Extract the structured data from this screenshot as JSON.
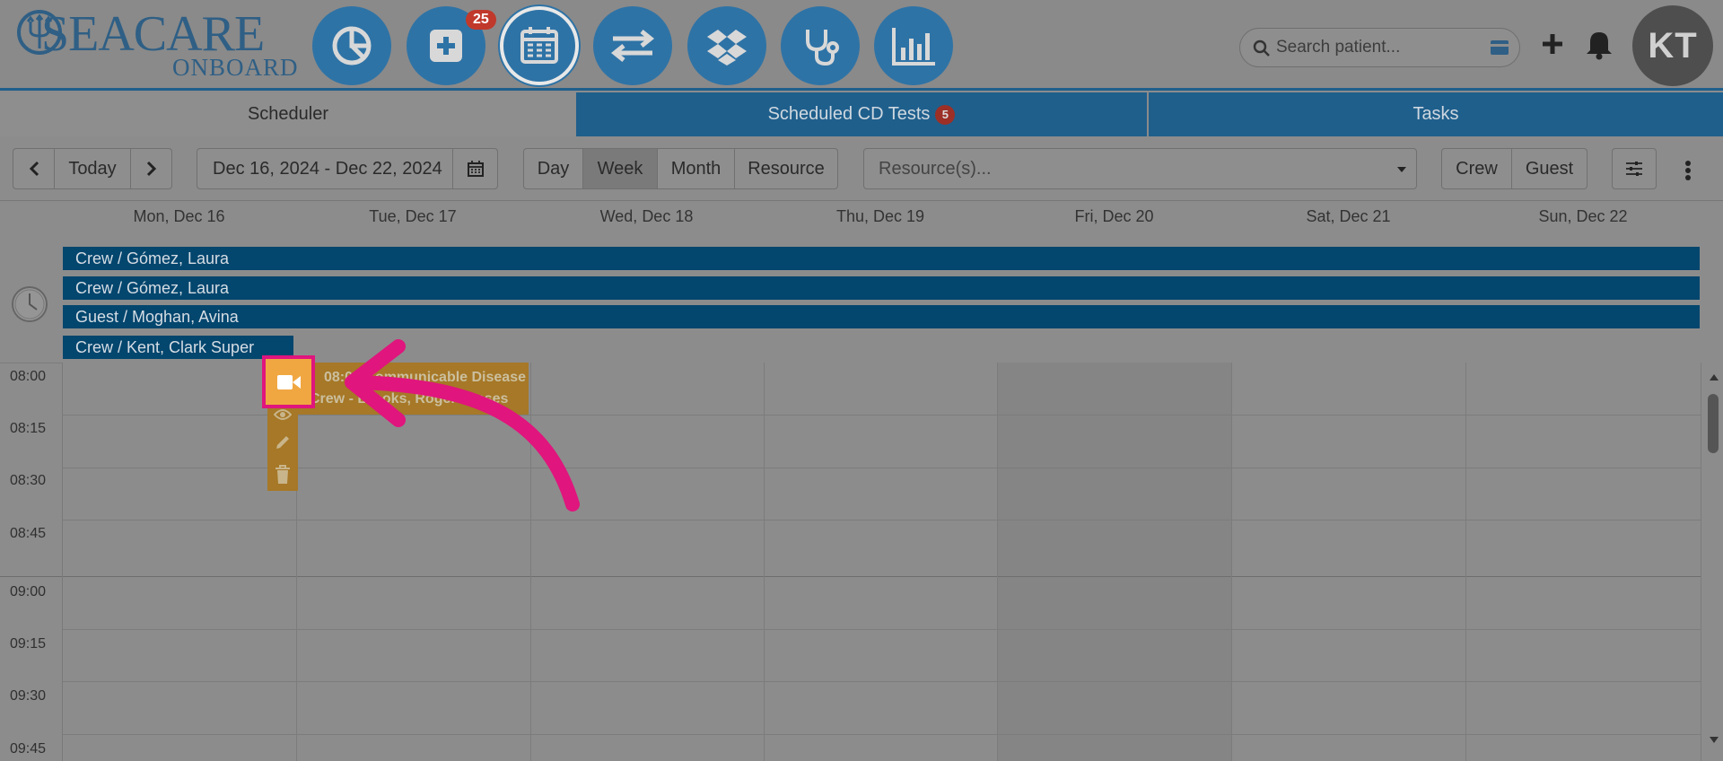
{
  "brand": {
    "name": "SEACARE",
    "sub": "ONBOARD"
  },
  "nav": {
    "items": [
      {
        "name": "dashboard-pie-icon"
      },
      {
        "name": "add-medical-icon",
        "badge": "25"
      },
      {
        "name": "calendar-icon",
        "active": true
      },
      {
        "name": "transfer-arrows-icon"
      },
      {
        "name": "dropbox-icon"
      },
      {
        "name": "stethoscope-icon"
      },
      {
        "name": "bar-chart-icon"
      }
    ]
  },
  "search": {
    "placeholder": "Search patient..."
  },
  "user": {
    "initials": "KT"
  },
  "tabs": {
    "scheduler": "Scheduler",
    "cd_tests": "Scheduled CD Tests",
    "cd_tests_count": "5",
    "tasks": "Tasks"
  },
  "toolbar": {
    "today": "Today",
    "date_range": "Dec 16, 2024 - Dec 22, 2024",
    "views": {
      "day": "Day",
      "week": "Week",
      "month": "Month",
      "resource": "Resource"
    },
    "selected_view": "Week",
    "resource_placeholder": "Resource(s)...",
    "crew": "Crew",
    "guest": "Guest"
  },
  "days": [
    "Mon, Dec 16",
    "Tue, Dec 17",
    "Wed, Dec 18",
    "Thu, Dec 19",
    "Fri, Dec 20",
    "Sat, Dec 21",
    "Sun, Dec 22"
  ],
  "all_day_events": [
    "Crew / Gómez, Laura",
    "Crew / Gómez, Laura",
    "Guest / Moghan, Avina",
    "Crew / Kent, Clark Super"
  ],
  "times": [
    "08:00",
    "08:15",
    "08:30",
    "08:45",
    "09:00",
    "09:15",
    "09:30",
    "09:45"
  ],
  "event": {
    "title": "08:00 Communicable Disease",
    "subtitle": "Crew - Brooks, Roger Jesses"
  },
  "colors": {
    "primary": "#2e73a6",
    "allday": "#03466e",
    "event": "#a67827",
    "highlight": "#e0157d",
    "video_button": "#f0a742"
  }
}
